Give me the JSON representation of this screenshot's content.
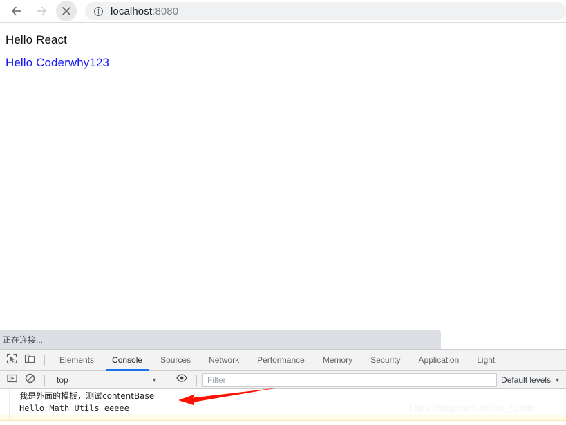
{
  "browser": {
    "back_icon": "arrow-left-icon",
    "forward_icon": "arrow-right-icon",
    "stop_icon": "close-x-icon",
    "info_icon": "info-circle-icon",
    "url_host": "localhost",
    "url_port": ":8080",
    "url_full": "localhost:8080"
  },
  "page": {
    "heading": "Hello React",
    "link_text": "Hello Coderwhy123",
    "link_color": "#1414ff"
  },
  "status": {
    "text": "正在连接..."
  },
  "devtools": {
    "inspect_icon": "inspect-element-icon",
    "device_icon": "device-toolbar-icon",
    "tabs": [
      {
        "label": "Elements",
        "active": false
      },
      {
        "label": "Console",
        "active": true
      },
      {
        "label": "Sources",
        "active": false
      },
      {
        "label": "Network",
        "active": false
      },
      {
        "label": "Performance",
        "active": false
      },
      {
        "label": "Memory",
        "active": false
      },
      {
        "label": "Security",
        "active": false
      },
      {
        "label": "Application",
        "active": false
      },
      {
        "label": "Light",
        "active": false
      }
    ],
    "active_tab_underline_color": "#1a73e8",
    "console_toolbar": {
      "sidebar_icon": "console-sidebar-icon",
      "clear_icon": "clear-console-icon",
      "context_value": "top",
      "context_caret": "▼",
      "eye_icon": "live-expression-eye-icon",
      "filter_placeholder": "Filter",
      "levels_value": "Default levels",
      "levels_caret": "▼"
    },
    "messages": [
      {
        "text": "我是外面的模板，测试contentBase",
        "style": "cjk"
      },
      {
        "text": "Hello Math Utils eeeee",
        "style": "mono"
      }
    ]
  },
  "annotation": {
    "arrow_name": "red-annotation-arrow",
    "arrow_color": "#fb1203"
  },
  "watermark": {
    "text": "https://blog.csdn.net/lin_fightin"
  }
}
